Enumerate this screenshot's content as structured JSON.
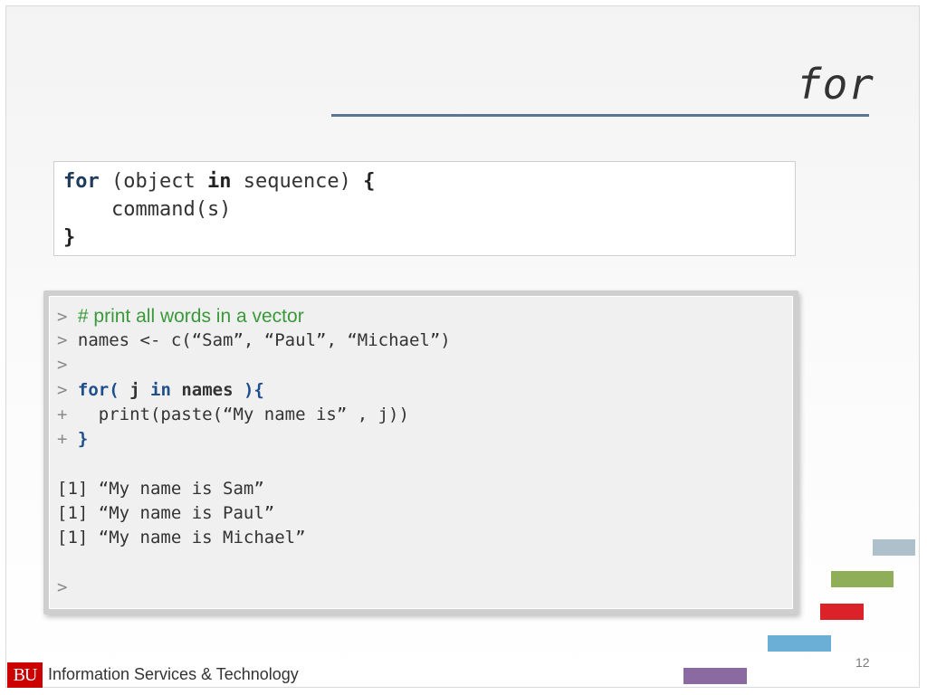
{
  "title": "for",
  "syntax": {
    "line1": {
      "kw_for": "for",
      "part1": " (object ",
      "kw_in": "in",
      "part2": " sequence) ",
      "brace_open": "{"
    },
    "line2": "    command(s)",
    "line3": "}"
  },
  "console": {
    "prompt": ">",
    "continuation": "+",
    "comment": "# print all words in a vector",
    "assign": "names <- c(“Sam”, “Paul”, “Michael”)",
    "for_kw": "for(",
    "var_j": " j ",
    "in_kw": "in",
    "names_kw": " names ",
    "paren_brace": "){",
    "print_line": "   print(paste(“My name is” , j))",
    "close_brace": "}",
    "outputs": [
      "[1] “My name is Sam”",
      "[1] “My name is Paul”",
      "[1] “My name is Michael”"
    ]
  },
  "footer": {
    "logo_text": "BU",
    "org": "Information Services & Technology",
    "page_number": "12"
  },
  "colors": {
    "accent_rule": "#5b7590",
    "keyword_blue": "#1f4e8c",
    "comment_green": "#3a9a3a",
    "deco_gray_blue": "#adc0cc",
    "deco_green": "#8eae57",
    "deco_red": "#dc2229",
    "deco_sky": "#6baed6",
    "deco_purple": "#8a6aa0",
    "logo_red": "#cc0000"
  }
}
